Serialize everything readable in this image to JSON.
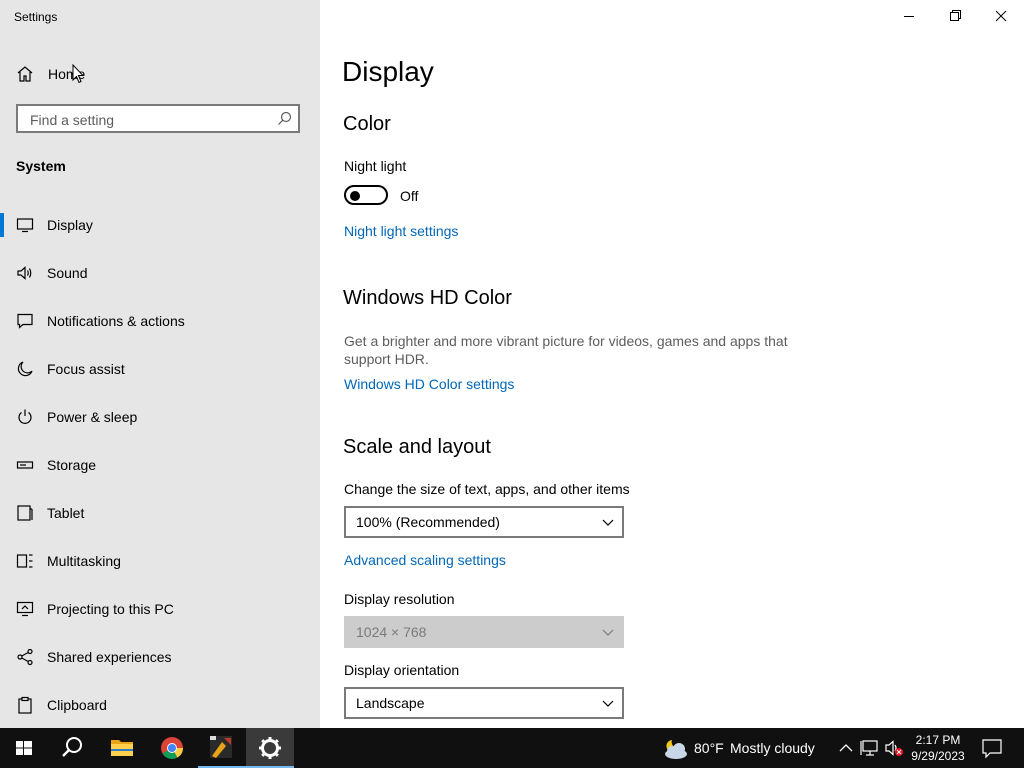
{
  "window": {
    "app_title": "Settings"
  },
  "sidebar": {
    "home_label": "Home",
    "search_placeholder": "Find a setting",
    "group_title": "System",
    "items": [
      {
        "label": "Display",
        "icon": "monitor-icon",
        "active": true
      },
      {
        "label": "Sound",
        "icon": "speaker-icon"
      },
      {
        "label": "Notifications & actions",
        "icon": "notification-icon"
      },
      {
        "label": "Focus assist",
        "icon": "moon-icon"
      },
      {
        "label": "Power & sleep",
        "icon": "power-icon"
      },
      {
        "label": "Storage",
        "icon": "storage-icon"
      },
      {
        "label": "Tablet",
        "icon": "tablet-icon"
      },
      {
        "label": "Multitasking",
        "icon": "multitasking-icon"
      },
      {
        "label": "Projecting to this PC",
        "icon": "projecting-icon"
      },
      {
        "label": "Shared experiences",
        "icon": "shared-icon"
      },
      {
        "label": "Clipboard",
        "icon": "clipboard-icon"
      }
    ]
  },
  "main": {
    "page_title": "Display",
    "color": {
      "title": "Color",
      "night_light_label": "Night light",
      "night_light_state": "Off",
      "night_light_on": false,
      "night_light_link": "Night light settings"
    },
    "hd_color": {
      "title": "Windows HD Color",
      "description": "Get a brighter and more vibrant picture for videos, games and apps that support HDR.",
      "link": "Windows HD Color settings"
    },
    "scale": {
      "title": "Scale and layout",
      "size_label": "Change the size of text, apps, and other items",
      "size_value": "100% (Recommended)",
      "advanced_link": "Advanced scaling settings",
      "resolution_label": "Display resolution",
      "resolution_value": "1024 × 768",
      "orientation_label": "Display orientation",
      "orientation_value": "Landscape"
    }
  },
  "taskbar": {
    "weather_temp": "80°F",
    "weather_condition": "Mostly cloudy",
    "time": "2:17 PM",
    "date": "9/29/2023"
  },
  "colors": {
    "accent": "#0078d4",
    "link": "#0067b8",
    "sidebar_bg": "#e6e6e6",
    "taskbar_bg": "#101010"
  }
}
